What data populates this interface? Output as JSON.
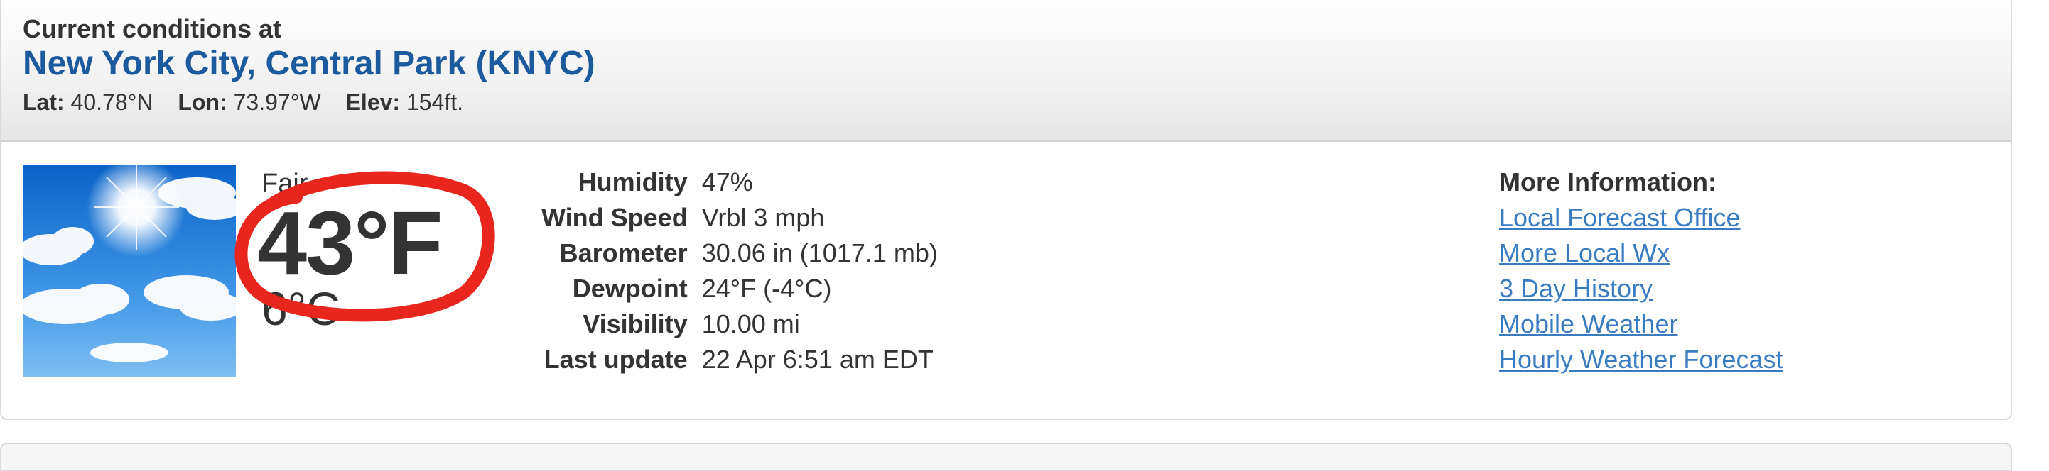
{
  "header": {
    "title": "Current conditions at",
    "station": "New York City, Central Park (KNYC)",
    "lat_label": "Lat:",
    "lat_value": "40.78°N",
    "lon_label": "Lon:",
    "lon_value": "73.97°W",
    "elev_label": "Elev:",
    "elev_value": "154ft."
  },
  "summary": {
    "condition": "Fair",
    "temp_f": "43°F",
    "temp_c": "6°C",
    "icon": "sunny-sky-with-clouds-image",
    "annotation_color": "#e8261d"
  },
  "details": [
    {
      "label": "Humidity",
      "value": "47%"
    },
    {
      "label": "Wind Speed",
      "value": "Vrbl 3 mph"
    },
    {
      "label": "Barometer",
      "value": "30.06 in (1017.1 mb)"
    },
    {
      "label": "Dewpoint",
      "value": "24°F (-4°C)"
    },
    {
      "label": "Visibility",
      "value": "10.00 mi"
    },
    {
      "label": "Last update",
      "value": "22 Apr 6:51 am EDT"
    }
  ],
  "more_info": {
    "title": "More Information:",
    "links": [
      "Local Forecast Office",
      "More Local Wx",
      "3 Day History",
      "Mobile Weather",
      "Hourly Weather Forecast"
    ]
  },
  "colors": {
    "station_link": "#1b5a9c",
    "info_link": "#3a7cc1",
    "text": "#333333"
  }
}
